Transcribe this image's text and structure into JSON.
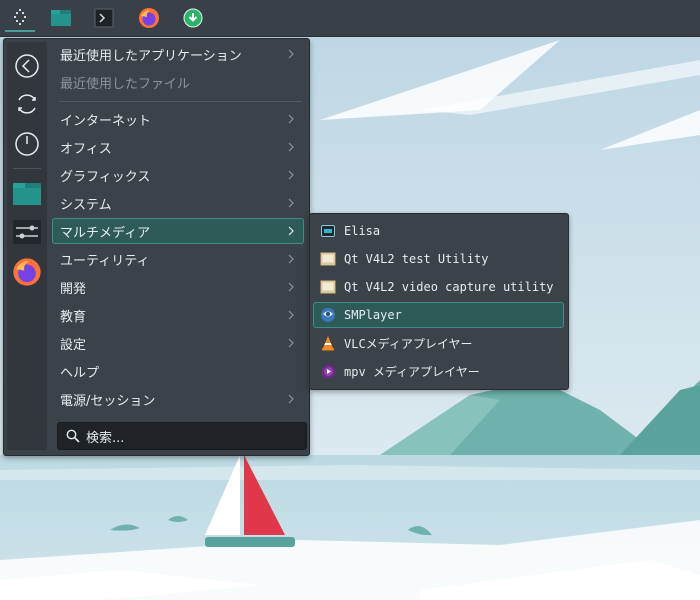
{
  "taskbar": {
    "items": [
      "launcher-icon",
      "file-manager-icon",
      "terminal-icon",
      "firefox-icon",
      "update-icon"
    ],
    "colors": {
      "bg": "#3a4048",
      "accent": "#4c9e9a"
    }
  },
  "side_rail": {
    "items": [
      "back-icon",
      "refresh-icon",
      "power-icon",
      "folder-icon",
      "settings-icon",
      "firefox-icon"
    ]
  },
  "menu": {
    "recent_apps": "最近使用したアプリケーション",
    "recent_files": "最近使用したファイル",
    "categories": [
      {
        "label": "インターネット",
        "submenu": true
      },
      {
        "label": "オフィス",
        "submenu": true
      },
      {
        "label": "グラフィックス",
        "submenu": true
      },
      {
        "label": "システム",
        "submenu": true
      },
      {
        "label": "マルチメディア",
        "submenu": true,
        "selected": true
      },
      {
        "label": "ユーティリティ",
        "submenu": true
      },
      {
        "label": "開発",
        "submenu": true
      },
      {
        "label": "教育",
        "submenu": true
      },
      {
        "label": "設定",
        "submenu": true
      },
      {
        "label": "ヘルプ",
        "submenu": false
      },
      {
        "label": "電源/セッション",
        "submenu": true
      }
    ],
    "search": {
      "placeholder": "検索..."
    }
  },
  "submenu": {
    "items": [
      {
        "label": "Elisa",
        "icon": "elisa-icon"
      },
      {
        "label": "Qt V4L2 test Utility",
        "icon": "qv4l2-icon"
      },
      {
        "label": "Qt V4L2 video capture utility",
        "icon": "qvidcap-icon"
      },
      {
        "label": "SMPlayer",
        "icon": "smplayer-icon",
        "selected": true
      },
      {
        "label": "VLCメディアプレイヤー",
        "icon": "vlc-icon"
      },
      {
        "label": "mpv メディアプレイヤー",
        "icon": "mpv-icon"
      }
    ]
  }
}
